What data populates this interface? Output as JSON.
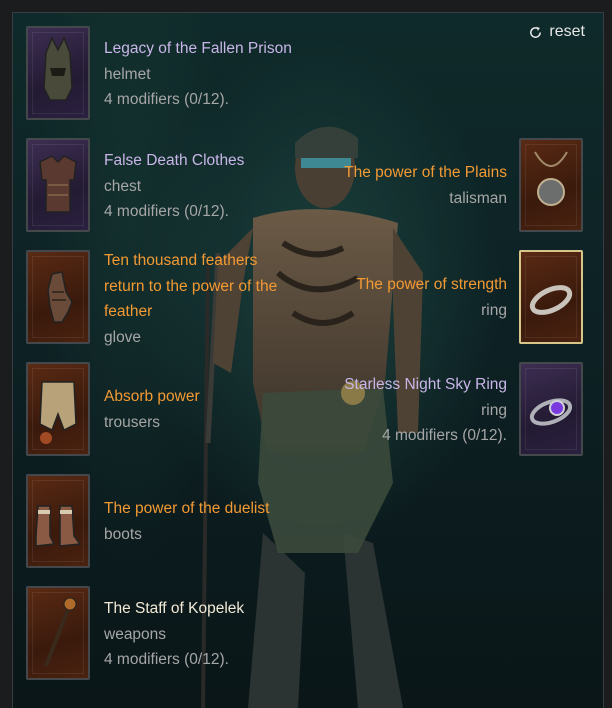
{
  "reset_label": "reset",
  "colors": {
    "purple_name": "#c8b6e8",
    "orange_name": "#f39a33",
    "unique_name": "#f2ead7",
    "sub_text": "#a6a6a6"
  },
  "left_slots": [
    {
      "name": "Legacy of the Fallen Prison",
      "type": "helmet",
      "modifiers": "4 modifiers (0/12).",
      "icon": "helmet-icon"
    },
    {
      "name": "False Death Clothes",
      "type": "chest",
      "modifiers": "4 modifiers (0/12).",
      "icon": "chest-armor-icon"
    },
    {
      "name": "Ten thousand feathers return to the power of the feather",
      "name_lines": [
        "Ten thousand feathers",
        "return to the power of the",
        "feather"
      ],
      "type": "glove",
      "icon": "glove-icon"
    },
    {
      "name": "Absorb power",
      "type": "trousers",
      "icon": "trousers-icon"
    },
    {
      "name": "The power of the duelist",
      "type": "boots",
      "icon": "boots-icon"
    },
    {
      "name": "The Staff of Kopelek",
      "type": "weapons",
      "modifiers": "4 modifiers (0/12).",
      "icon": "staff-icon"
    }
  ],
  "right_slots": [
    {
      "name": "The power of the Plains",
      "type": "talisman",
      "icon": "amulet-icon"
    },
    {
      "name": "The power of strength",
      "type": "ring",
      "icon": "ring-icon",
      "selected": true
    },
    {
      "name": "Starless Night Sky Ring",
      "type": "ring",
      "modifiers": "4 modifiers (0/12).",
      "icon": "gem-ring-icon"
    }
  ]
}
